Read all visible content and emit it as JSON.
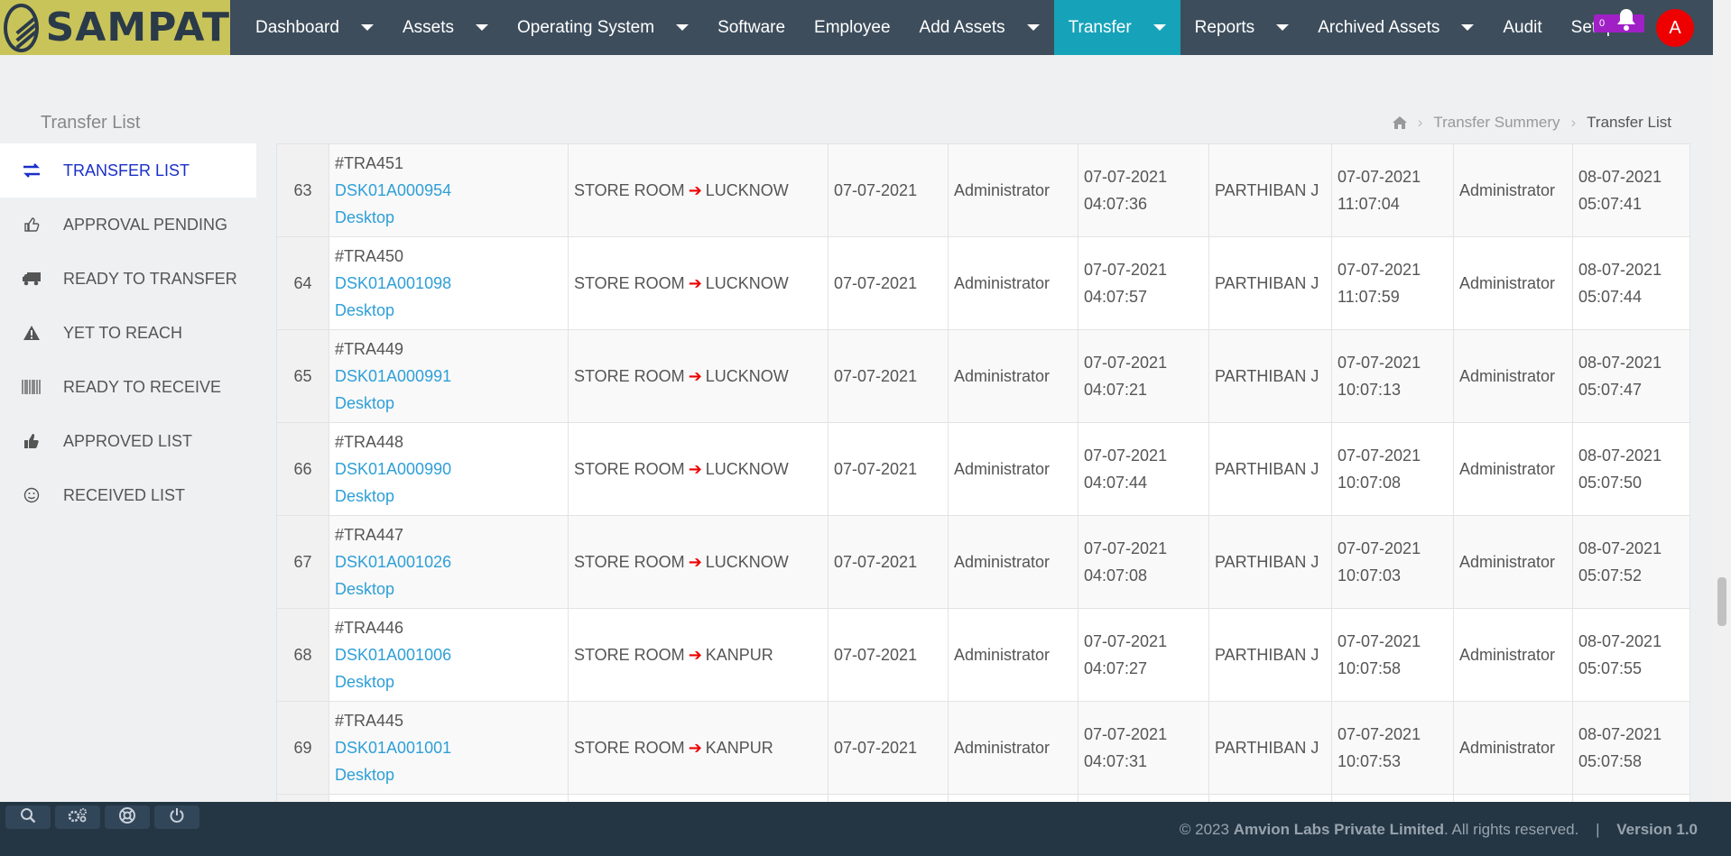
{
  "brand": {
    "name": "SAMPAT"
  },
  "nav": [
    {
      "label": "Dashboard",
      "caret": true
    },
    {
      "label": "Assets",
      "caret": true
    },
    {
      "label": "Operating System",
      "caret": true
    },
    {
      "label": "Software",
      "caret": false
    },
    {
      "label": "Employee",
      "caret": false
    },
    {
      "label": "Add Assets",
      "caret": true
    },
    {
      "label": "Transfer",
      "caret": true,
      "active": true
    },
    {
      "label": "Reports",
      "caret": true
    },
    {
      "label": "Archived Assets",
      "caret": true
    },
    {
      "label": "Audit",
      "caret": false
    },
    {
      "label": "Setup",
      "caret": false
    }
  ],
  "notifications": {
    "count": "0",
    "icon": "bell-icon"
  },
  "user": {
    "initial": "A"
  },
  "page": {
    "title": "Transfer List"
  },
  "breadcrumb": {
    "home_icon": "home-icon",
    "parent": "Transfer Summery",
    "current": "Transfer List"
  },
  "sidebar": [
    {
      "label": "TRANSFER LIST",
      "icon": "exchange-icon",
      "active": true
    },
    {
      "label": "APPROVAL PENDING",
      "icon": "thumbs-up-outline-icon"
    },
    {
      "label": "READY TO TRANSFER",
      "icon": "truck-icon"
    },
    {
      "label": "YET TO REACH",
      "icon": "warning-icon"
    },
    {
      "label": "READY TO RECEIVE",
      "icon": "barcode-icon"
    },
    {
      "label": "APPROVED LIST",
      "icon": "thumbs-up-icon"
    },
    {
      "label": "RECEIVED LIST",
      "icon": "smile-icon"
    }
  ],
  "rows": [
    {
      "num": "63",
      "tra": "#TRA451",
      "asset": "DSK01A000954",
      "type": "Desktop",
      "from": "STORE ROOM",
      "to": "LUCKNOW",
      "date": "07-07-2021",
      "by": "Administrator",
      "dt1a": "07-07-2021",
      "dt1b": "04:07:36",
      "emp": "PARTHIBAN J",
      "dt2a": "07-07-2021",
      "dt2b": "11:07:04",
      "by2": "Administrator",
      "dt3a": "08-07-2021",
      "dt3b": "05:07:41"
    },
    {
      "num": "64",
      "tra": "#TRA450",
      "asset": "DSK01A001098",
      "type": "Desktop",
      "from": "STORE ROOM",
      "to": "LUCKNOW",
      "date": "07-07-2021",
      "by": "Administrator",
      "dt1a": "07-07-2021",
      "dt1b": "04:07:57",
      "emp": "PARTHIBAN J",
      "dt2a": "07-07-2021",
      "dt2b": "11:07:59",
      "by2": "Administrator",
      "dt3a": "08-07-2021",
      "dt3b": "05:07:44"
    },
    {
      "num": "65",
      "tra": "#TRA449",
      "asset": "DSK01A000991",
      "type": "Desktop",
      "from": "STORE ROOM",
      "to": "LUCKNOW",
      "date": "07-07-2021",
      "by": "Administrator",
      "dt1a": "07-07-2021",
      "dt1b": "04:07:21",
      "emp": "PARTHIBAN J",
      "dt2a": "07-07-2021",
      "dt2b": "10:07:13",
      "by2": "Administrator",
      "dt3a": "08-07-2021",
      "dt3b": "05:07:47"
    },
    {
      "num": "66",
      "tra": "#TRA448",
      "asset": "DSK01A000990",
      "type": "Desktop",
      "from": "STORE ROOM",
      "to": "LUCKNOW",
      "date": "07-07-2021",
      "by": "Administrator",
      "dt1a": "07-07-2021",
      "dt1b": "04:07:44",
      "emp": "PARTHIBAN J",
      "dt2a": "07-07-2021",
      "dt2b": "10:07:08",
      "by2": "Administrator",
      "dt3a": "08-07-2021",
      "dt3b": "05:07:50"
    },
    {
      "num": "67",
      "tra": "#TRA447",
      "asset": "DSK01A001026",
      "type": "Desktop",
      "from": "STORE ROOM",
      "to": "LUCKNOW",
      "date": "07-07-2021",
      "by": "Administrator",
      "dt1a": "07-07-2021",
      "dt1b": "04:07:08",
      "emp": "PARTHIBAN J",
      "dt2a": "07-07-2021",
      "dt2b": "10:07:03",
      "by2": "Administrator",
      "dt3a": "08-07-2021",
      "dt3b": "05:07:52"
    },
    {
      "num": "68",
      "tra": "#TRA446",
      "asset": "DSK01A001006",
      "type": "Desktop",
      "from": "STORE ROOM",
      "to": "KANPUR",
      "date": "07-07-2021",
      "by": "Administrator",
      "dt1a": "07-07-2021",
      "dt1b": "04:07:27",
      "emp": "PARTHIBAN J",
      "dt2a": "07-07-2021",
      "dt2b": "10:07:58",
      "by2": "Administrator",
      "dt3a": "08-07-2021",
      "dt3b": "05:07:55"
    },
    {
      "num": "69",
      "tra": "#TRA445",
      "asset": "DSK01A001001",
      "type": "Desktop",
      "from": "STORE ROOM",
      "to": "KANPUR",
      "date": "07-07-2021",
      "by": "Administrator",
      "dt1a": "07-07-2021",
      "dt1b": "04:07:31",
      "emp": "PARTHIBAN J",
      "dt2a": "07-07-2021",
      "dt2b": "10:07:53",
      "by2": "Administrator",
      "dt3a": "08-07-2021",
      "dt3b": "05:07:58"
    }
  ],
  "footer": {
    "copyright": "© 2023",
    "company": "Amvion Labs Private Limited",
    "rights": ". All rights reserved.",
    "pipe": "|",
    "version": "Version 1.0",
    "tools": [
      "search-icon",
      "gears-icon",
      "lifebuoy-icon",
      "power-icon"
    ]
  },
  "colors": {
    "nav_bg": "#3d4d5c",
    "nav_active": "#16a3ba",
    "brand_bg": "#c9c45a",
    "link": "#2e9fd8",
    "arrow": "#e00000",
    "footer_bg": "#243644",
    "avatar": "#e00000",
    "badge": "#a020c6"
  }
}
